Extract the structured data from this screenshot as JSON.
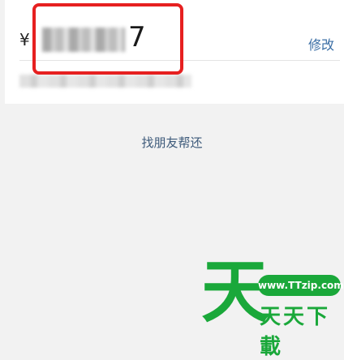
{
  "amount": {
    "currency_symbol": "¥",
    "visible_digit": "7",
    "edit_label": "修改"
  },
  "actions": {
    "ask_friend_label": "找朋友帮还"
  },
  "watermark": {
    "logo_char": "天",
    "url": "www.TTzip.com",
    "text": "天天下載"
  },
  "colors": {
    "link": "#3a6ea5",
    "highlight": "#e62020",
    "logo": "#1aa83a"
  }
}
